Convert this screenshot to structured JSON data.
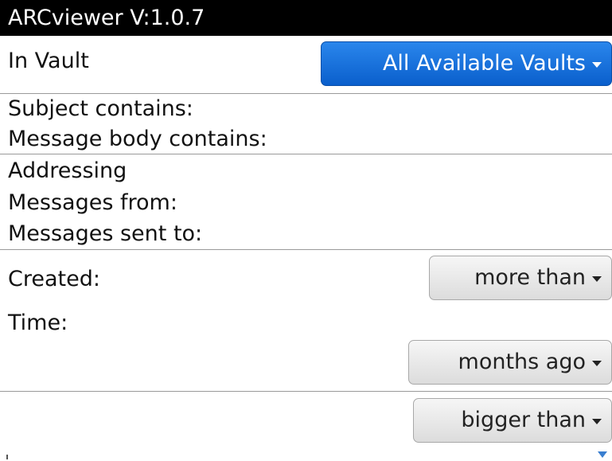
{
  "app": {
    "title": "ARCviewer V:1.0.7"
  },
  "vault": {
    "label": "In Vault",
    "dropdown_value": "All Available Vaults"
  },
  "content_filters": {
    "subject_label": "Subject contains:",
    "body_label": "Message body contains:"
  },
  "addressing": {
    "heading": "Addressing",
    "from_label": "Messages from:",
    "sent_to_label": "Messages sent to:"
  },
  "created": {
    "label": "Created:",
    "comparison_value": "more than",
    "time_label": "Time:",
    "unit_value": "months ago"
  },
  "size": {
    "comparison_value": "bigger than"
  },
  "colors": {
    "title_bar": "#000000",
    "accent_button": "#1a6fdc",
    "scroll_indicator": "#3a7fd0"
  }
}
